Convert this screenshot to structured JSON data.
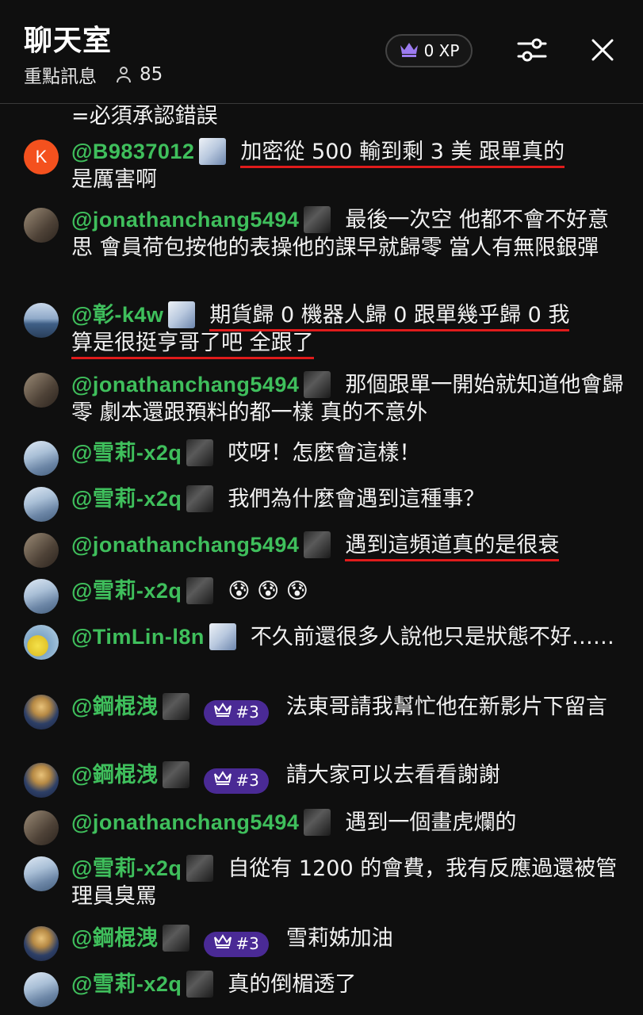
{
  "header": {
    "title": "聊天室",
    "subtitle": "重點訊息",
    "viewer_count": "85",
    "xp_label": "0 XP"
  },
  "icons": {
    "viewer": "person-icon",
    "xp": "crown-icon",
    "filter": "sliders-icon",
    "close": "close-icon",
    "rank": "crown-icon"
  },
  "colors": {
    "author": "#3fbf5c",
    "rank_badge": "#4a2a95",
    "highlight": "#e01b1b",
    "background": "#0f0f0f"
  },
  "chat": {
    "partial_text": "=必須承認錯誤",
    "messages": [
      {
        "author": "@B9837012",
        "avatar_text": "K",
        "text": "加密從 500 輸到剩 3 美 跟單真的",
        "text2": "是厲害啊"
      },
      {
        "author": "@jonathanchang5494",
        "text": "最後一次空 他都不會不好意思 會員荷包按他的表操他的課早就歸零 當人有無限銀彈"
      },
      {
        "author": "@彰-k4w",
        "text": "期貨歸 0 機器人歸 0 跟單幾乎歸 0 我",
        "text2": "算是很挺亨哥了吧 全跟了"
      },
      {
        "author": "@jonathanchang5494",
        "text": "那個跟單一開始就知道他會歸零 劇本還跟預料的都一樣 真的不意外"
      },
      {
        "author": "@雪莉-x2q",
        "text": "哎呀！怎麼會這樣！"
      },
      {
        "author": "@雪莉-x2q",
        "text": "我們為什麼會遇到這種事？"
      },
      {
        "author": "@jonathanchang5494",
        "text": "遇到這頻道真的是很衰"
      },
      {
        "author": "@雪莉-x2q",
        "text": "😰 😰 😰"
      },
      {
        "author": "@TimLin-l8n",
        "text": "不久前還很多人說他只是狀態不好……"
      },
      {
        "author": "@鋼棍洩",
        "rank": "#3",
        "text": "法東哥請我幫忙他在新影片下留言"
      },
      {
        "author": "@鋼棍洩",
        "rank": "#3",
        "text": "請大家可以去看看謝謝"
      },
      {
        "author": "@jonathanchang5494",
        "text": "遇到一個畫虎爛的"
      },
      {
        "author": "@雪莉-x2q",
        "text": "自從有 1200 的會費，我有反應過還被管理員臭罵"
      },
      {
        "author": "@鋼棍洩",
        "rank": "#3",
        "text": "雪莉姊加油"
      },
      {
        "author": "@雪莉-x2q",
        "text": "真的倒楣透了"
      }
    ]
  }
}
